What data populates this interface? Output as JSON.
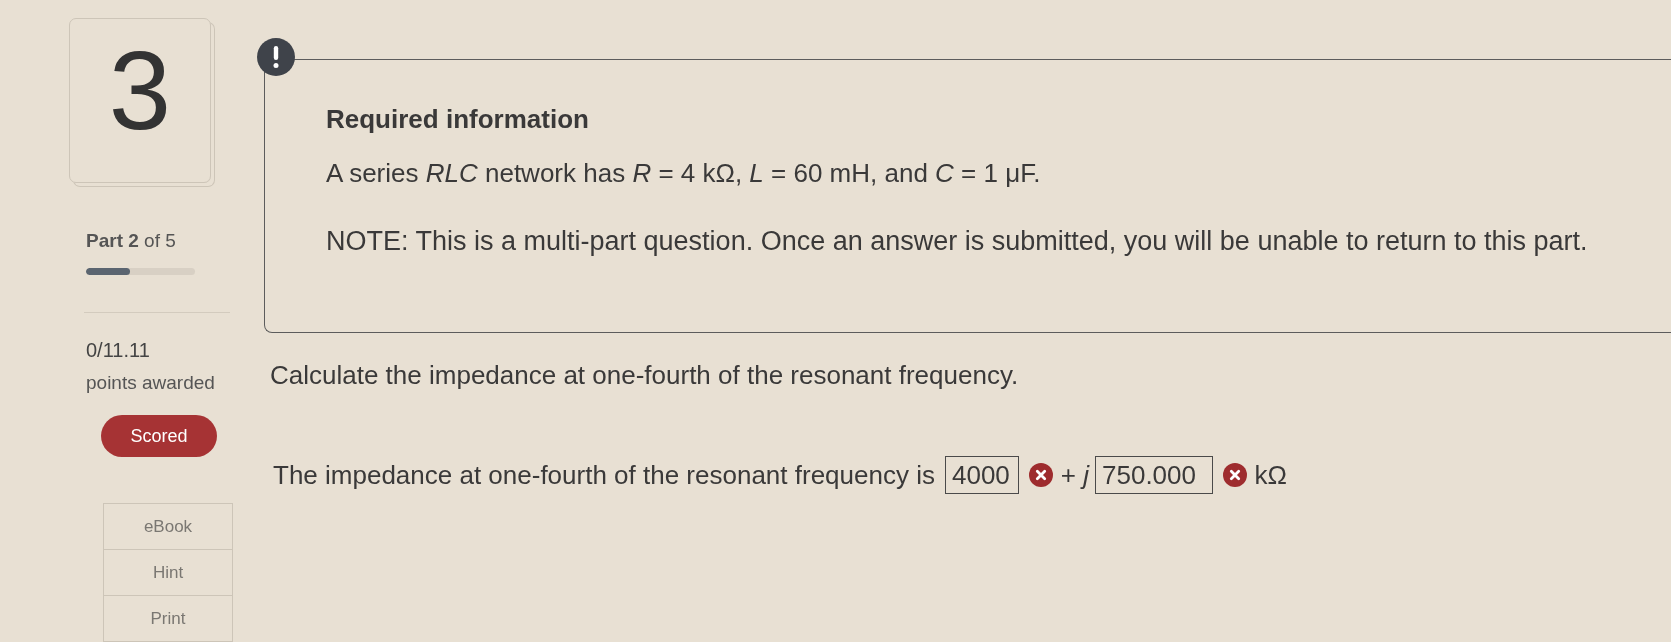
{
  "question": {
    "number": "3",
    "part": "**Part 2** of 5",
    "progress": {
      "level": 0.4
    },
    "score": "0/11.11",
    "score_label": "points awarded",
    "status": "Scored",
    "tools": [
      {
        "label": "eBook"
      },
      {
        "label": "Hint"
      },
      {
        "label": "Print"
      }
    ]
  },
  "required_info": {
    "title": "Required information",
    "statement": "A series *RLC* network has *R* = 4 kΩ, *L* = 60 mH, and *C* = 1 μF.",
    "note": "NOTE: This is a multi-part question. Once an answer is submitted, you will be unable to return to this part."
  },
  "prompt": "Calculate the impedance at one-fourth of the resonant frequency.",
  "answer": {
    "lead": "The impedance at one-fourth of the resonant frequency is",
    "parts": [
      {
        "kind": "field",
        "value": "4000",
        "correct": false
      },
      {
        "kind": "text",
        "text": "+ *j*"
      },
      {
        "kind": "field",
        "value": "750.000",
        "correct": false
      },
      {
        "kind": "text",
        "text": "kΩ"
      }
    ]
  }
}
